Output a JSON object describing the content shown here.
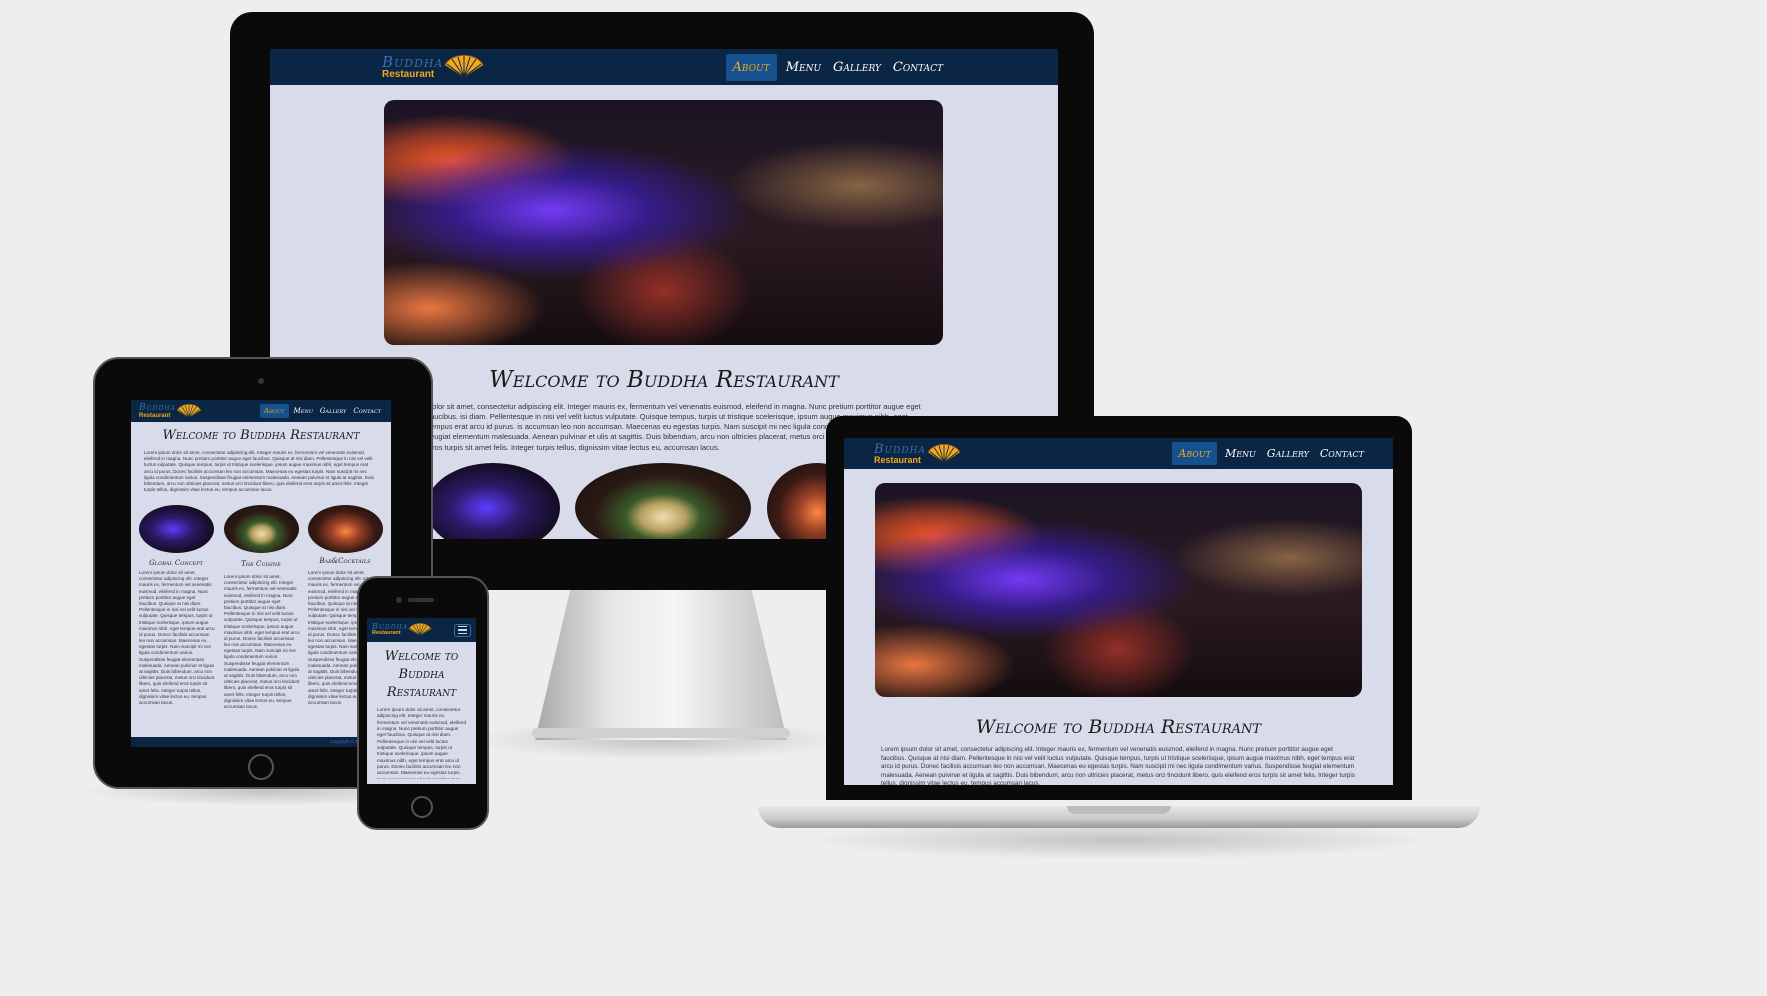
{
  "site": {
    "logo_main": "Buddha",
    "logo_sub": "Restaurant",
    "nav": [
      {
        "label": "About",
        "active": true
      },
      {
        "label": "Menu",
        "active": false
      },
      {
        "label": "Gallery",
        "active": false
      },
      {
        "label": "Contact",
        "active": false
      }
    ],
    "heading": "Welcome to Buddha Restaurant",
    "heading_phone_1": "Welcome to",
    "heading_phone_2": "Buddha",
    "heading_phone_3": "Restaurant",
    "intro": "Lorem ipsum dolor sit amet, consectetur adipiscing elit. Integer mauris ex, fermentum vel venenatis euismod, eleifend in magna. Nunc pretium porttitor augue eget faucibus. Quisque at nisi diam. Pellentesque in nisi vel velit luctus vulputate. Quisque tempus, turpis ut tristique scelerisque, ipsum augue maximus nibh, eget tempus erat arcu id purus. Donec facilisis accumsan leo non accumsan. Maecenas eu egestas turpis. Nam suscipit mi nec ligula condimentum varius. Suspendisse feugiat elementum malesuada. Aenean pulvinar et ligula at sagittis. Duis bibendum, arcu non ultricies placerat, metus orci tincidunt libero, quis eleifend eros turpis sit amet felis. Integer turpis tellus, dignissim vitae lectus eu, tempus accumsan lacus.",
    "imac_intro_visible": "dolor sit amet, consectetur adipiscing elit. Integer mauris ex, fermentum vel venenatis euismod, eleifend in magna. Nunc pretium porttitor augue eget faucibus. isi diam. Pellentesque in nisi vel velit luctus vulputate. Quisque tempus, turpis ut tristique scelerisque, ipsum augue maximus nibh, eget tempus erat arcu id purus. is accumsan leo non accumsan. Maecenas eu egestas turpis. Nam suscipit mi nec ligula condimentum varius. Suspendisse feugiat elementum malesuada. Aenean pulvinar et ulis at sagittis. Duis bibendum, arcu non ultricies placerat, metus orci tincidunt libero, quis eleifend eros turpis sit amet felis. Integer turpis tellus, dignissim vitae lectus eu, accumsan lacus.",
    "columns": [
      {
        "title": "Global Concept",
        "text": "Lorem ipsum dolor sit amet, consectetur adipiscing elit. Integer mauris ex, fermentum vel venenatis euismod, eleifend in magna. Nunc pretium porttitor augue eget faucibus. Quisque at nisi diam. Pellentesque in nisi vel velit luctus vulputate. Quisque tempus, turpis ut tristique scelerisque, ipsum augue maximus nibh, eget tempus erat arcu id purus. Donec facilisis accumsan leo non accumsan. Maecenas eu egestas turpis. Nam suscipit mi nec ligula condimentum varius. Suspendisse feugiat elementum malesuada. Aenean pulvinar et ligula at sagittis. Duis bibendum, arcu non ultricies placerat, metus orci tincidunt libero, quis eleifend eros turpis sit amet felis. Integer turpis tellus, dignissim vitae lectus eu, tempus accumsan lacus."
      },
      {
        "title": "The Cuisine",
        "text": "Lorem ipsum dolor sit amet, consectetur adipiscing elit. Integer mauris ex, fermentum vel venenatis euismod, eleifend in magna. Nunc pretium porttitor augue eget faucibus. Quisque at nisi diam. Pellentesque in nisi vel velit luctus vulputate. Quisque tempus, turpis ut tristique scelerisque, ipsum augue maximus nibh, eget tempus erat arcu id purus. Donec facilisis accumsan leo non accumsan. Maecenas eu egestas turpis. Nam suscipit mi nec ligula condimentum varius. Suspendisse feugiat elementum malesuada. Aenean pulvinar et ligula at sagittis. Duis bibendum, arcu non ultricies placerat, metus orci tincidunt libero, quis eleifend eros turpis sit amet felis. Integer turpis tellus, dignissim vitae lectus eu, tempus accumsan lacus."
      },
      {
        "title": "Bar&Cocktails",
        "text": "Lorem ipsum dolor sit amet, consectetur adipiscing elit. Integer mauris ex, fermentum vel venenatis euismod, eleifend in magna. Nunc pretium porttitor augue eget faucibus. Quisque at nisi diam. Pellentesque in nisi vel velit luctus vulputate. Quisque tempus, turpis ut tristique scelerisque, ipsum augue maximus nibh, eget tempus erat arcu id purus. Donec facilisis accumsan leo non accumsan. Maecenas eu egestas turpis. Nam suscipit mi nec ligula condimentum varius. Suspendisse feugiat elementum malesuada. Aenean pulvinar et ligula at sagittis. Duis bibendum, arcu non ultricies placerat, metus orci tincidunt libero, quis eleifend eros turpis sit amet felis. Integer turpis tellus, dignissim vitae lectus eu, tempus accumsan lacus."
      }
    ],
    "footer": "Copyright © Buddha"
  },
  "colors": {
    "navbar": "#0b2545",
    "accent": "#f0a91e",
    "active_nav": "#15508f",
    "page_bg": "#d8dcea",
    "backdrop": "#eeeeee"
  },
  "icons": {
    "logo": "fan-icon",
    "mobile_menu": "hamburger-menu-icon"
  }
}
